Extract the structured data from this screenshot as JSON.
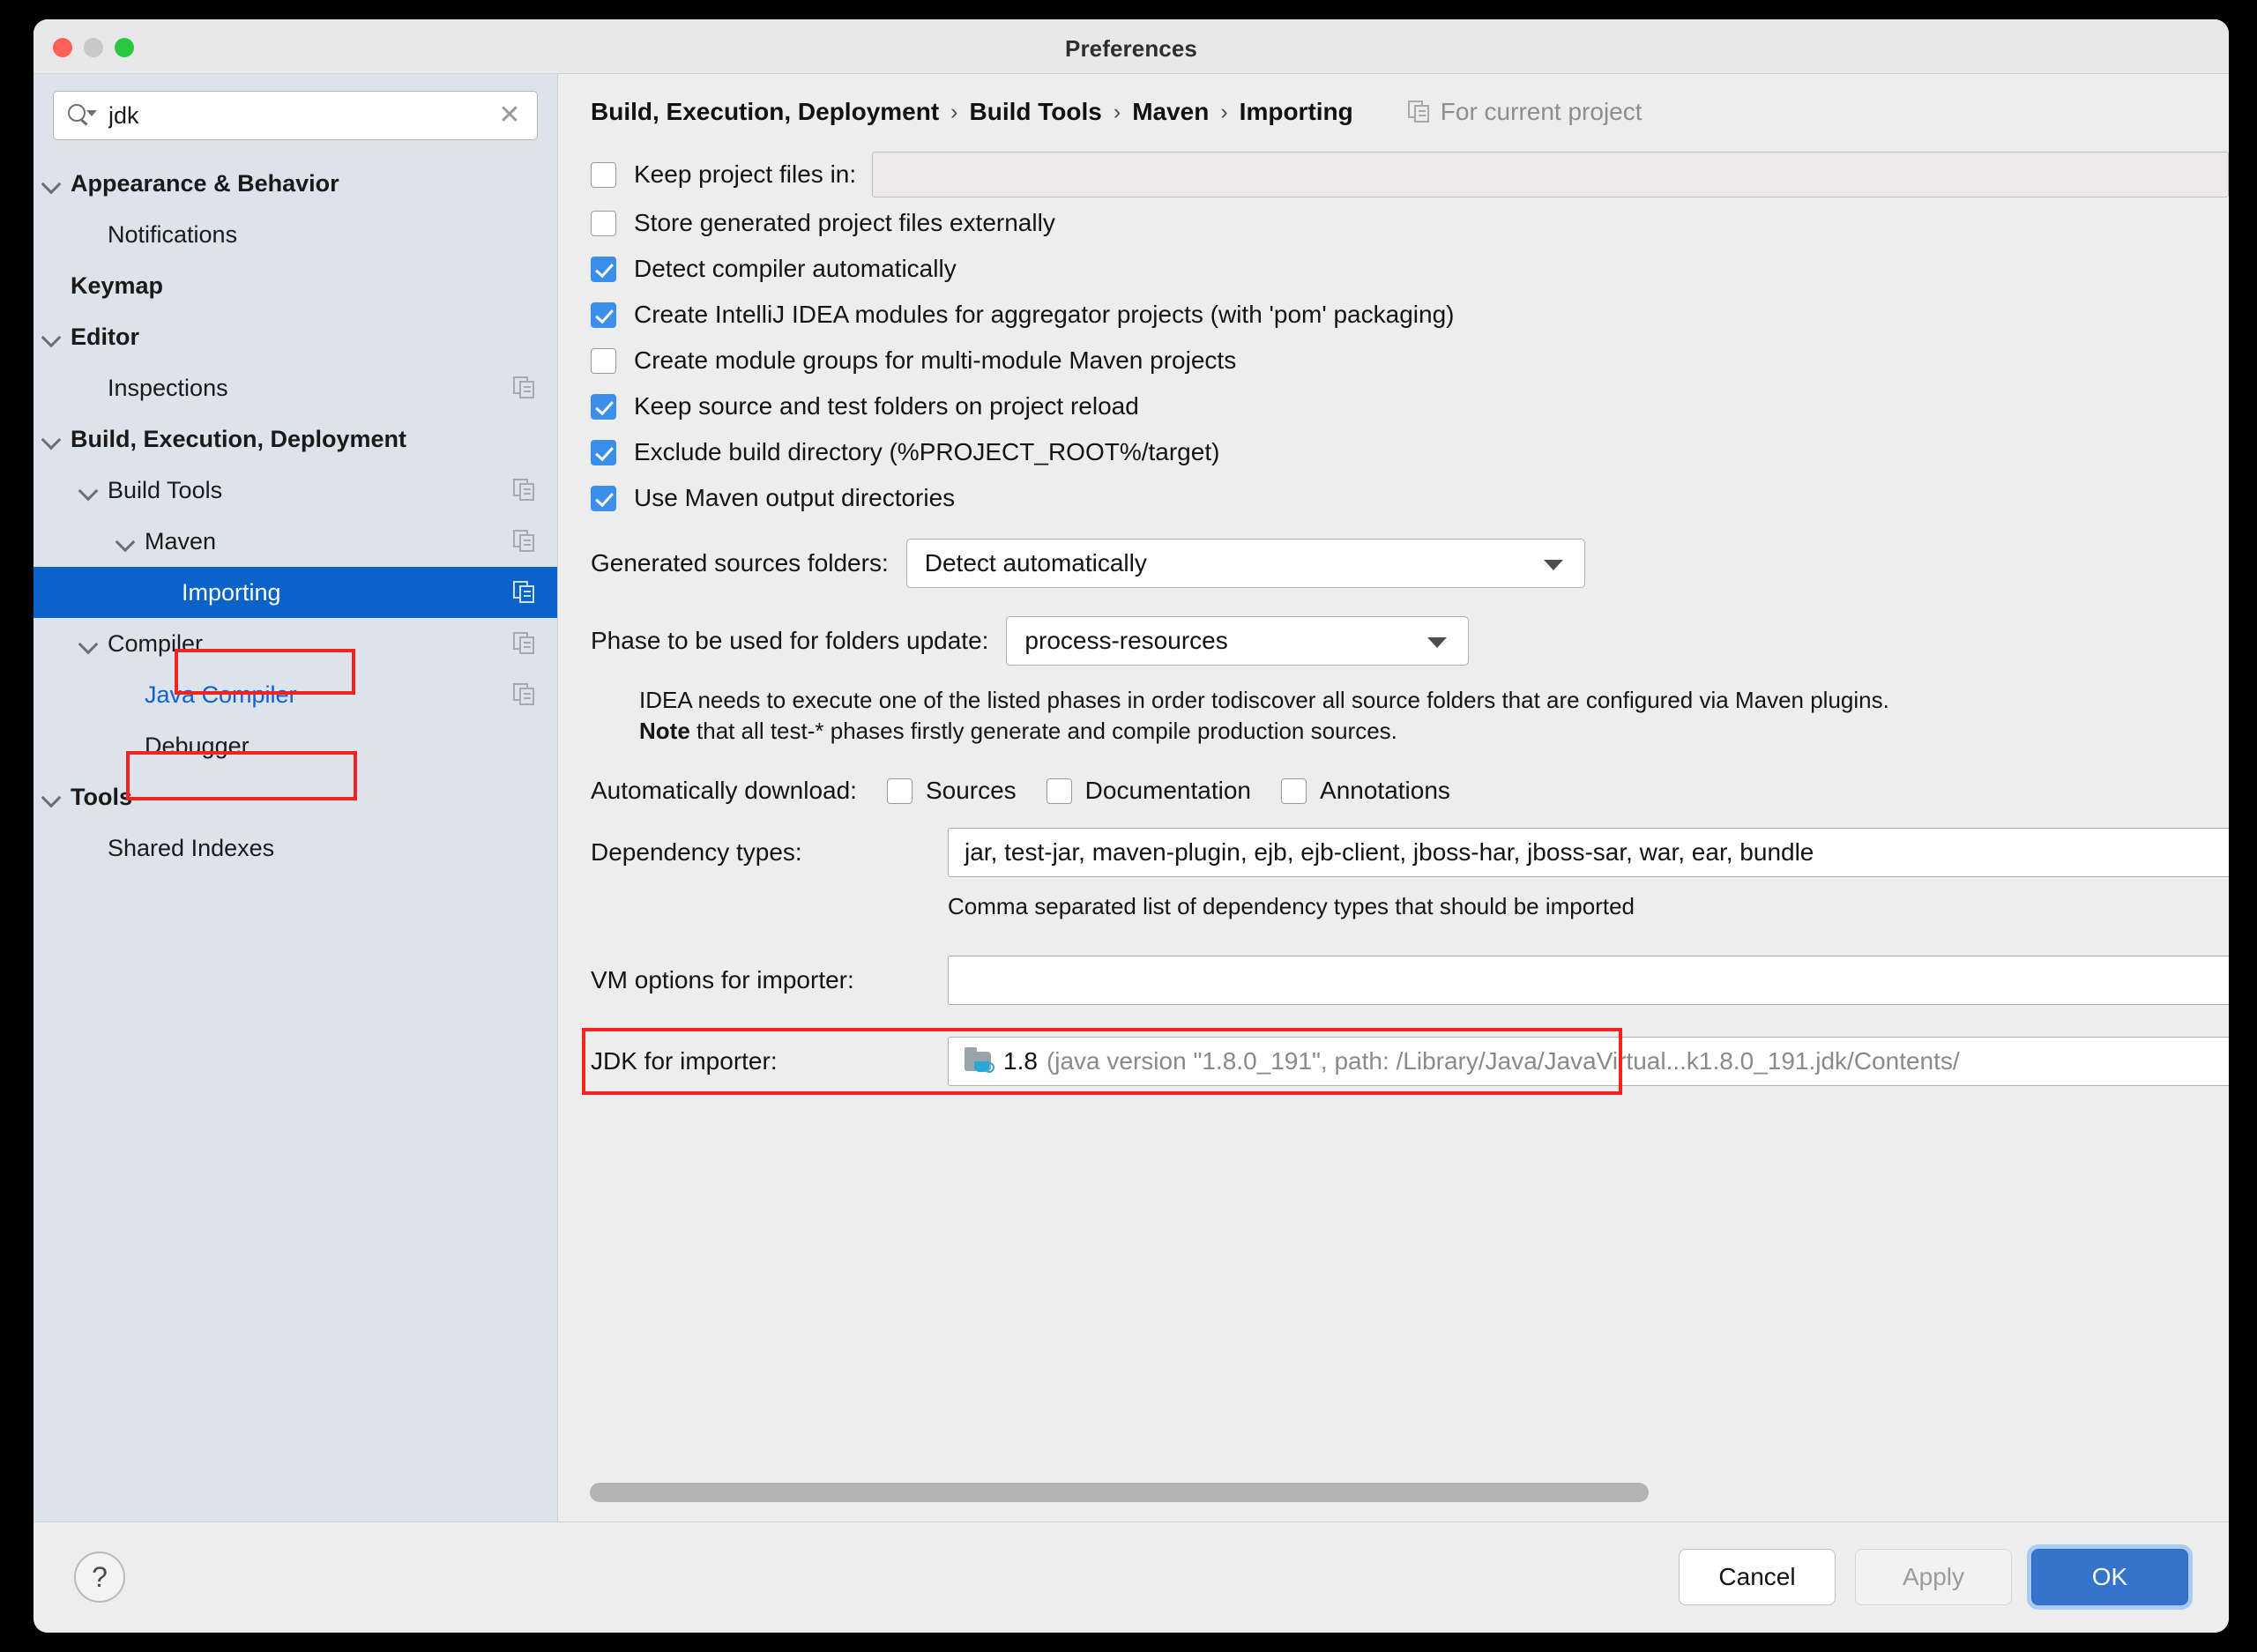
{
  "window": {
    "title": "Preferences"
  },
  "search": {
    "value": "jdk",
    "placeholder": "",
    "clear_glyph": "✕"
  },
  "sidebar": {
    "items": [
      {
        "label": "Appearance & Behavior",
        "indent": 0,
        "bold": true,
        "twisty": true,
        "copy": false,
        "selected": false,
        "link": false
      },
      {
        "label": "Notifications",
        "indent": 1,
        "bold": false,
        "twisty": false,
        "copy": false,
        "selected": false,
        "link": false
      },
      {
        "label": "Keymap",
        "indent": 0,
        "bold": true,
        "twisty": false,
        "copy": false,
        "selected": false,
        "link": false
      },
      {
        "label": "Editor",
        "indent": 0,
        "bold": true,
        "twisty": true,
        "copy": false,
        "selected": false,
        "link": false
      },
      {
        "label": "Inspections",
        "indent": 1,
        "bold": false,
        "twisty": false,
        "copy": true,
        "selected": false,
        "link": false
      },
      {
        "label": "Build, Execution, Deployment",
        "indent": 0,
        "bold": true,
        "twisty": true,
        "copy": false,
        "selected": false,
        "link": false
      },
      {
        "label": "Build Tools",
        "indent": 1,
        "bold": false,
        "twisty": true,
        "copy": true,
        "selected": false,
        "link": false
      },
      {
        "label": "Maven",
        "indent": 2,
        "bold": false,
        "twisty": true,
        "copy": true,
        "selected": false,
        "link": false
      },
      {
        "label": "Importing",
        "indent": 3,
        "bold": false,
        "twisty": false,
        "copy": true,
        "selected": true,
        "link": false
      },
      {
        "label": "Compiler",
        "indent": 1,
        "bold": false,
        "twisty": true,
        "copy": true,
        "selected": false,
        "link": false
      },
      {
        "label": "Java Compiler",
        "indent": 2,
        "bold": false,
        "twisty": false,
        "copy": true,
        "selected": false,
        "link": true
      },
      {
        "label": "Debugger",
        "indent": 2,
        "bold": false,
        "twisty": false,
        "copy": false,
        "selected": false,
        "link": false
      },
      {
        "label": "Tools",
        "indent": 0,
        "bold": true,
        "twisty": true,
        "copy": false,
        "selected": false,
        "link": false
      },
      {
        "label": "Shared Indexes",
        "indent": 1,
        "bold": false,
        "twisty": false,
        "copy": false,
        "selected": false,
        "link": false
      }
    ]
  },
  "header": {
    "breadcrumb": [
      "Build, Execution, Deployment",
      "Build Tools",
      "Maven",
      "Importing"
    ],
    "separator": "›",
    "for_current_project": "For current project"
  },
  "main": {
    "keep_project_files": {
      "label": "Keep project files in:",
      "checked": false,
      "value": ""
    },
    "checkboxes": [
      {
        "label": "Store generated project files externally",
        "checked": false
      },
      {
        "label": "Detect compiler automatically",
        "checked": true
      },
      {
        "label": "Create IntelliJ IDEA modules for aggregator projects (with 'pom' packaging)",
        "checked": true
      },
      {
        "label": "Create module groups for multi-module Maven projects",
        "checked": false
      },
      {
        "label": "Keep source and test folders on project reload",
        "checked": true
      },
      {
        "label": "Exclude build directory (%PROJECT_ROOT%/target)",
        "checked": true
      },
      {
        "label": "Use Maven output directories",
        "checked": true
      }
    ],
    "generated_sources": {
      "label": "Generated sources folders:",
      "value": "Detect automatically"
    },
    "phase_update": {
      "label": "Phase to be used for folders update:",
      "value": "process-resources"
    },
    "note_line1": "IDEA needs to execute one of the listed phases in order todiscover all source folders that are configured via Maven plugins.",
    "note_bold": "Note",
    "note_line2_rest": " that all test-* phases firstly generate and compile production sources.",
    "auto_download": {
      "label": "Automatically download:",
      "options": [
        {
          "label": "Sources",
          "checked": false
        },
        {
          "label": "Documentation",
          "checked": false
        },
        {
          "label": "Annotations",
          "checked": false
        }
      ]
    },
    "dependency_types": {
      "label": "Dependency types:",
      "value": "jar, test-jar, maven-plugin, ejb, ejb-client, jboss-har, jboss-sar, war, ear, bundle",
      "help": "Comma separated list of dependency types that should be imported"
    },
    "vm_options": {
      "label": "VM options for importer:",
      "value": ""
    },
    "jdk_importer": {
      "label": "JDK for importer:",
      "version": "1.8",
      "path": "(java version \"1.8.0_191\", path: /Library/Java/JavaVirtual...k1.8.0_191.jdk/Contents/"
    }
  },
  "footer": {
    "help_glyph": "?",
    "cancel": "Cancel",
    "apply": "Apply",
    "ok": "OK"
  },
  "colors": {
    "selection_blue": "#0a63c9",
    "link_blue": "#1161d6",
    "annotation_red": "#f5231f",
    "primary_button": "#3574cd",
    "checkbox_blue": "#3b8eea"
  }
}
